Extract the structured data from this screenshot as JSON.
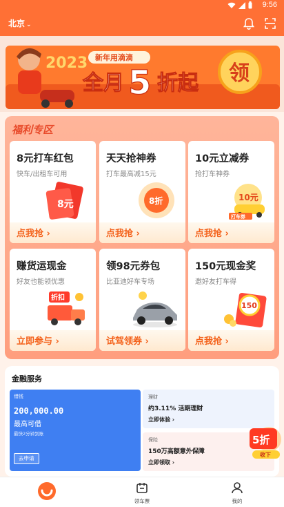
{
  "status_bar": {
    "time": "9:56"
  },
  "header": {
    "city": "北京"
  },
  "banner": {
    "tagline": "新年用滴滴",
    "headline_pre": "全月",
    "headline_num": "5",
    "headline_post": "折起",
    "year": "2023",
    "claim_label": "领"
  },
  "welfare": {
    "title": "福利专区",
    "cards": [
      {
        "title": "8元打车红包",
        "subtitle": "快车/出租车可用",
        "cta": "点我抢",
        "art_text": "8元"
      },
      {
        "title": "天天抢神券",
        "subtitle": "打车最高减15元",
        "cta": "点我抢",
        "art_text": "8折"
      },
      {
        "title": "10元立减券",
        "subtitle": "抢打车神券",
        "cta": "点我抢",
        "art_text": "10元",
        "art_tag": "打车券"
      },
      {
        "title": "赚货运现金",
        "subtitle": "好友也能领优惠",
        "cta": "立即参与",
        "art_text": "折扣"
      },
      {
        "title": "领98元券包",
        "subtitle": "比亚迪好车专场",
        "cta": "试驾领券",
        "art_text": ""
      },
      {
        "title": "150元现金奖",
        "subtitle": "邀好友打车得",
        "cta": "点我抢",
        "art_text": "150"
      }
    ]
  },
  "finance": {
    "title": "金融服务",
    "loan": {
      "tag": "借钱",
      "amount": "200,000.00",
      "desc": "最高可借",
      "note": "最快2分钟到账",
      "button": "去申请"
    },
    "items": [
      {
        "tag": "理财",
        "desc": "约3.11% 活期理财",
        "link": "立即体验"
      },
      {
        "tag": "保险",
        "desc": "150万高额意外保障",
        "link": "立即领取"
      }
    ]
  },
  "float_badge": {
    "text": "5折",
    "sub": "收下"
  },
  "tabbar": {
    "items": [
      {
        "label": "",
        "icon": "didi-home-icon"
      },
      {
        "label": "领车票",
        "icon": "ticket-icon"
      },
      {
        "label": "我的",
        "icon": "person-icon"
      }
    ]
  },
  "colors": {
    "brand": "#ff7035",
    "accent": "#f4621b",
    "loan_blue": "#3f7ff2"
  }
}
